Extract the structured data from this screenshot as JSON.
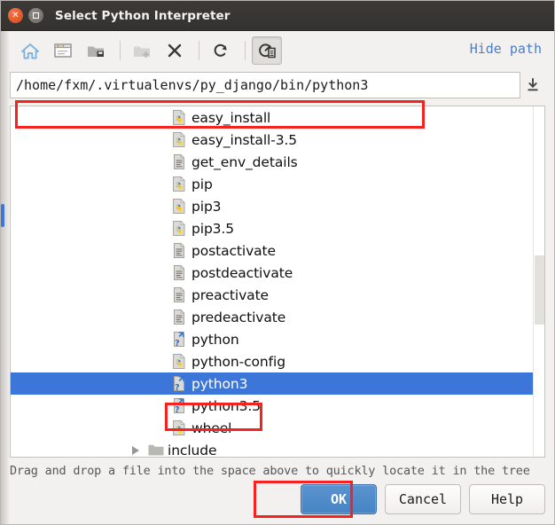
{
  "window": {
    "title": "Select Python Interpreter",
    "close_label": "×",
    "maximize_label": "maximize"
  },
  "toolbar": {
    "buttons": [
      {
        "name": "home-icon",
        "label": "Home",
        "state": "enabled"
      },
      {
        "name": "desktop-icon",
        "label": "Desktop",
        "state": "enabled"
      },
      {
        "name": "folder-drive-icon",
        "label": "Project Directory",
        "state": "enabled"
      },
      {
        "name": "new-folder-icon",
        "label": "New Folder",
        "state": "disabled"
      },
      {
        "name": "delete-icon",
        "label": "Delete",
        "state": "enabled"
      },
      {
        "name": "refresh-icon",
        "label": "Refresh",
        "state": "enabled"
      },
      {
        "name": "show-hidden-icon",
        "label": "Show Hidden Files and Directories",
        "state": "pressed"
      }
    ],
    "hide_path_label": "Hide path"
  },
  "path": {
    "value": "/home/fxm/.virtualenvs/py_django/bin/python3",
    "placeholder": "",
    "dropdown_icon": "download-arrow-icon"
  },
  "file_tree": {
    "rows": [
      {
        "label": "easy_install",
        "icon": "python-file-icon",
        "type": "file",
        "selected": false
      },
      {
        "label": "easy_install-3.5",
        "icon": "python-file-icon",
        "type": "file",
        "selected": false
      },
      {
        "label": "get_env_details",
        "icon": "text-file-icon",
        "type": "file",
        "selected": false
      },
      {
        "label": "pip",
        "icon": "python-file-icon",
        "type": "file",
        "selected": false
      },
      {
        "label": "pip3",
        "icon": "python-file-icon",
        "type": "file",
        "selected": false
      },
      {
        "label": "pip3.5",
        "icon": "python-file-icon",
        "type": "file",
        "selected": false
      },
      {
        "label": "postactivate",
        "icon": "text-file-icon",
        "type": "file",
        "selected": false
      },
      {
        "label": "postdeactivate",
        "icon": "text-file-icon",
        "type": "file",
        "selected": false
      },
      {
        "label": "preactivate",
        "icon": "text-file-icon",
        "type": "file",
        "selected": false
      },
      {
        "label": "predeactivate",
        "icon": "text-file-icon",
        "type": "file",
        "selected": false
      },
      {
        "label": "python",
        "icon": "symlink-file-icon",
        "type": "symlink",
        "selected": false
      },
      {
        "label": "python-config",
        "icon": "python-file-icon",
        "type": "file",
        "selected": false
      },
      {
        "label": "python3",
        "icon": "symlink-file-icon",
        "type": "symlink",
        "selected": true
      },
      {
        "label": "python3.5",
        "icon": "symlink-file-icon",
        "type": "symlink",
        "selected": false
      },
      {
        "label": "wheel",
        "icon": "python-file-icon",
        "type": "file",
        "selected": false
      },
      {
        "label": "include",
        "icon": "folder-icon",
        "type": "folder",
        "selected": false
      }
    ]
  },
  "hint": {
    "text": "Drag and drop a file into the space above to quickly locate it in the tree"
  },
  "buttons": {
    "ok": "OK",
    "cancel": "Cancel",
    "help": "Help"
  },
  "colors": {
    "selection_blue": "#3b76d8",
    "annotation_red": "#f5231f",
    "link_blue": "#4a7ec8",
    "titlebar": "#3d3b37",
    "close_orange": "#dd4814",
    "primary_button": "#4684c4"
  }
}
